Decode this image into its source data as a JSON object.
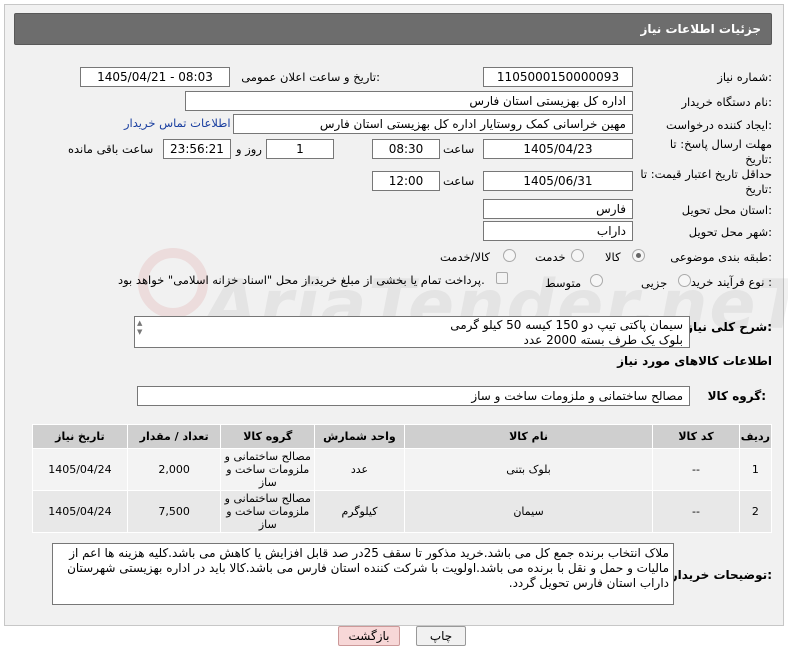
{
  "header": {
    "title": "جزئیات اطلاعات نیاز"
  },
  "fields": {
    "need_number_label": "شماره نیاز:",
    "need_number": "1105000150000093",
    "announce_label": "تاریخ و ساعت اعلان عمومی:",
    "announce_value": "1405/04/21 - 08:03",
    "buyer_org_label": "نام دستگاه خریدار:",
    "buyer_org": "اداره کل بهزیستی استان فارس",
    "requester_label": "ایجاد کننده درخواست:",
    "requester": "مهین خراسانی کمک روستایار اداره کل بهزیستی استان فارس",
    "contact_link": "اطلاعات تماس خریدار",
    "deadline_label": "مهلت ارسال پاسخ: تا تاریخ:",
    "deadline_date": "1405/04/23",
    "time_label": "ساعت",
    "deadline_time": "08:30",
    "days_count": "1",
    "days_label": "روز و",
    "remaining_time": "23:56:21",
    "remaining_label": "ساعت باقی مانده",
    "validity_label": "حداقل تاریخ اعتبار قیمت: تا تاریخ:",
    "validity_date": "1405/06/31",
    "validity_time": "12:00",
    "province_label": "استان محل تحویل:",
    "province": "فارس",
    "city_label": "شهر محل تحویل:",
    "city": "داراب",
    "category_label": "طبقه بندی موضوعی:",
    "category_options": [
      "کالا",
      "خدمت",
      "کالا/خدمت"
    ],
    "category_selected": "کالا",
    "process_label": "نوع فرآیند خرید :",
    "process_options": [
      "جزیی",
      "متوسط"
    ],
    "process_note": "پرداخت تمام یا بخشی از مبلغ خرید،از محل \"اسناد خزانه اسلامی\" خواهد بود."
  },
  "summary": {
    "label": "شرح کلی نیاز:",
    "line1": "سیمان پاکتی تیپ دو    150  کیسه 50 کیلو گرمی",
    "line2": "بلوک یک طرف بسته     2000  عدد"
  },
  "goods_section": {
    "title": "اطلاعات کالاهای مورد نیاز",
    "group_label": "گروه کالا:",
    "group_value": "مصالح ساختمانی و ملزومات ساخت و ساز"
  },
  "table": {
    "headers": [
      "ردیف",
      "کد کالا",
      "نام کالا",
      "واحد شمارش",
      "گروه کالا",
      "تعداد / مقدار",
      "تاریخ نیاز"
    ],
    "rows": [
      [
        "1",
        "--",
        "بلوک بتنی",
        "عدد",
        "مصالح ساختمانی و ملزومات ساخت و ساز",
        "2,000",
        "1405/04/24"
      ],
      [
        "2",
        "--",
        "سیمان",
        "کیلوگرم",
        "مصالح ساختمانی و ملزومات ساخت و ساز",
        "7,500",
        "1405/04/24"
      ]
    ]
  },
  "buyer_notes": {
    "label": "توضیحات خریدار:",
    "text": "ملاک انتخاب برنده جمع کل می باشد.خرید مذکور تا سقف 25در صد قابل افزایش یا کاهش می باشد.کلیه هزینه ها اعم از مالیات و حمل و نقل با برنده می باشد.اولویت با شرکت کننده استان فارس می باشد.کالا باید در اداره بهزیستی  شهرستان داراب  استان فارس تحویل گردد."
  },
  "buttons": {
    "print": "چاپ",
    "back": "بازگشت"
  },
  "watermark": "AriaTender.neT",
  "colors": {
    "header_bg": "#6d6d6d",
    "back_button": "#f7d7d7",
    "link": "#1a3fa0"
  }
}
